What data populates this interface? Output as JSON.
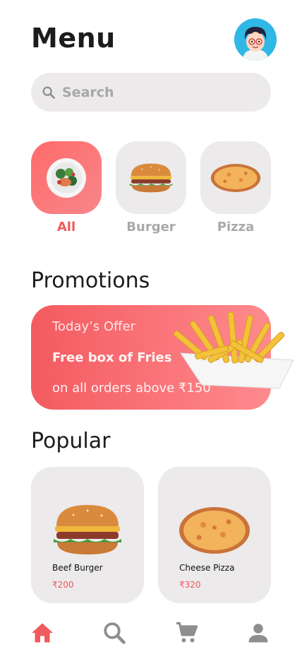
{
  "header": {
    "title": "Menu",
    "avatar_icon": "avatar-icon"
  },
  "search": {
    "placeholder": "Search",
    "icon": "search-icon"
  },
  "categories": [
    {
      "label": "All",
      "icon": "salad-icon",
      "active": true
    },
    {
      "label": "Burger",
      "icon": "burger-icon",
      "active": false
    },
    {
      "label": "Pizza",
      "icon": "pizza-icon",
      "active": false
    }
  ],
  "promotions": {
    "heading": "Promotions",
    "line1": "Today’s Offer",
    "line2": "Free box of Fries",
    "line3": "on all orders above ₹150",
    "image": "fries-icon"
  },
  "popular": {
    "heading": "Popular",
    "items": [
      {
        "name": "Beef Burger",
        "price": "₹200",
        "image": "burger-icon"
      },
      {
        "name": "Cheese Pizza",
        "price": "₹320",
        "image": "pizza-icon"
      }
    ]
  },
  "bottom_nav": [
    {
      "icon": "home-icon",
      "active": true
    },
    {
      "icon": "search-icon",
      "active": false
    },
    {
      "icon": "cart-icon",
      "active": false
    },
    {
      "icon": "profile-icon",
      "active": false
    }
  ],
  "colors": {
    "accent": "#f05a5e",
    "tile": "#eceaea",
    "muted": "#a9a9a9"
  }
}
